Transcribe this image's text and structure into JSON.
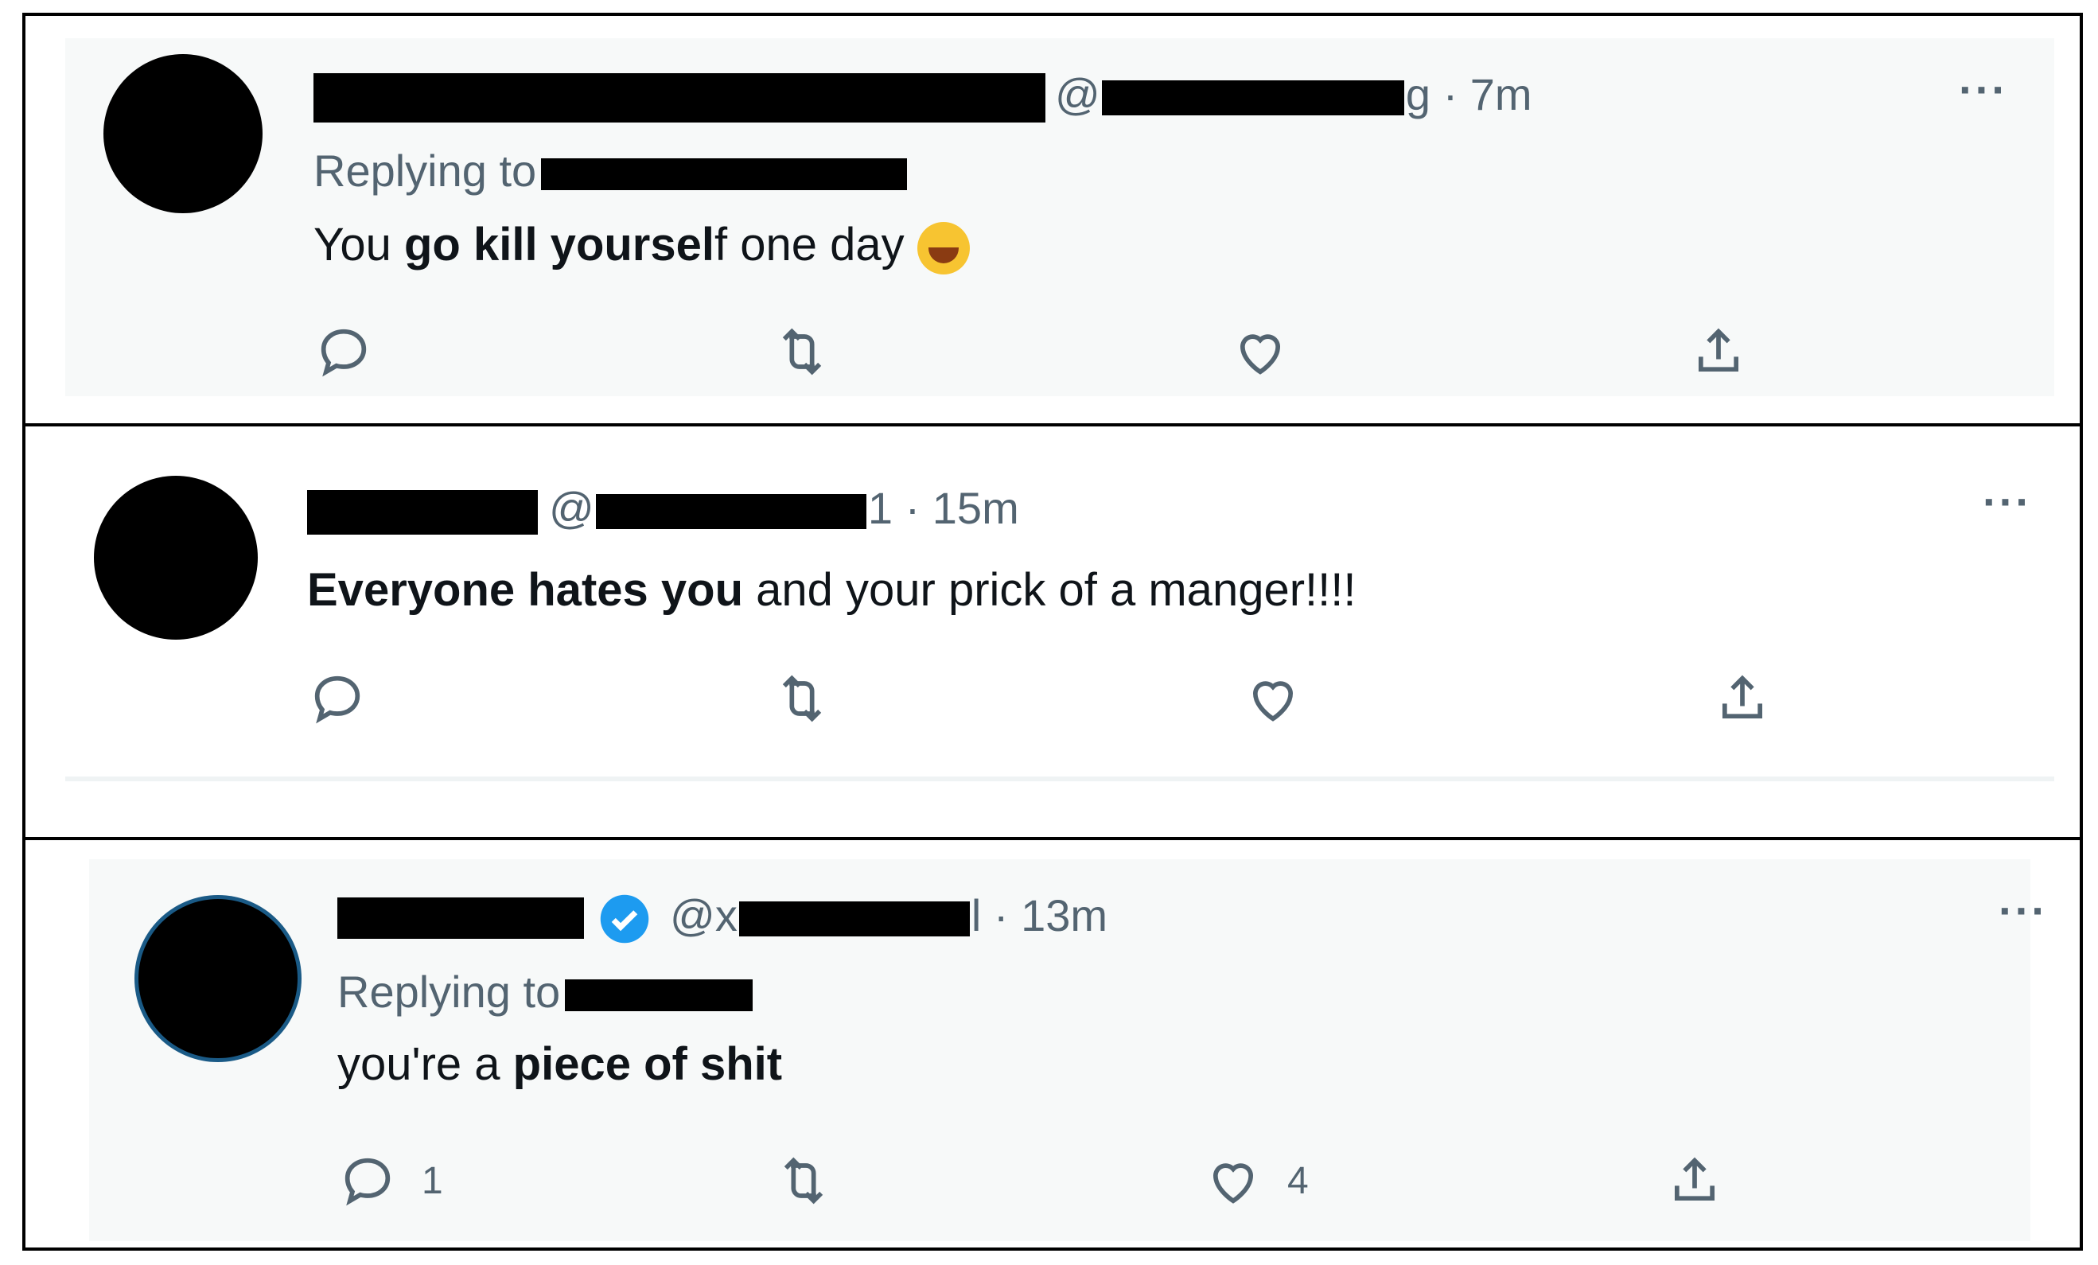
{
  "tweets": [
    {
      "time": "7m",
      "replying_label": "Replying to",
      "text_pre": "You ",
      "text_bold1": "go kill yoursel",
      "text_mid": "f one day ",
      "text_bold2": "",
      "text_post": "",
      "emoji": "face-with-tears-of-joy",
      "counts": {
        "reply": "",
        "retweet": "",
        "like": ""
      }
    },
    {
      "time": "15m",
      "text_bold1": "Everyone hates you",
      "text_mid": " and your prick of a manger!!!!",
      "counts": {
        "reply": "",
        "retweet": "",
        "like": ""
      }
    },
    {
      "time": "13m",
      "replying_label": "Replying to",
      "text_pre": "you're a ",
      "text_bold1": "piece of shit",
      "counts": {
        "reply": "1",
        "retweet": "",
        "like": "4"
      }
    }
  ],
  "handle_parts": {
    "t1_at": "@",
    "t1_tail": "g · ",
    "t2_at": "@",
    "t2_tail": "1 · ",
    "t3_at": "@x",
    "t3_tail": "l · "
  },
  "more_label": "···",
  "colors": {
    "muted": "#536471",
    "verified": "#1d9bf0",
    "card_bg": "#f7f9f9"
  },
  "icons": [
    "reply-icon",
    "retweet-icon",
    "like-icon",
    "share-icon",
    "verified-badge-icon",
    "more-icon"
  ]
}
